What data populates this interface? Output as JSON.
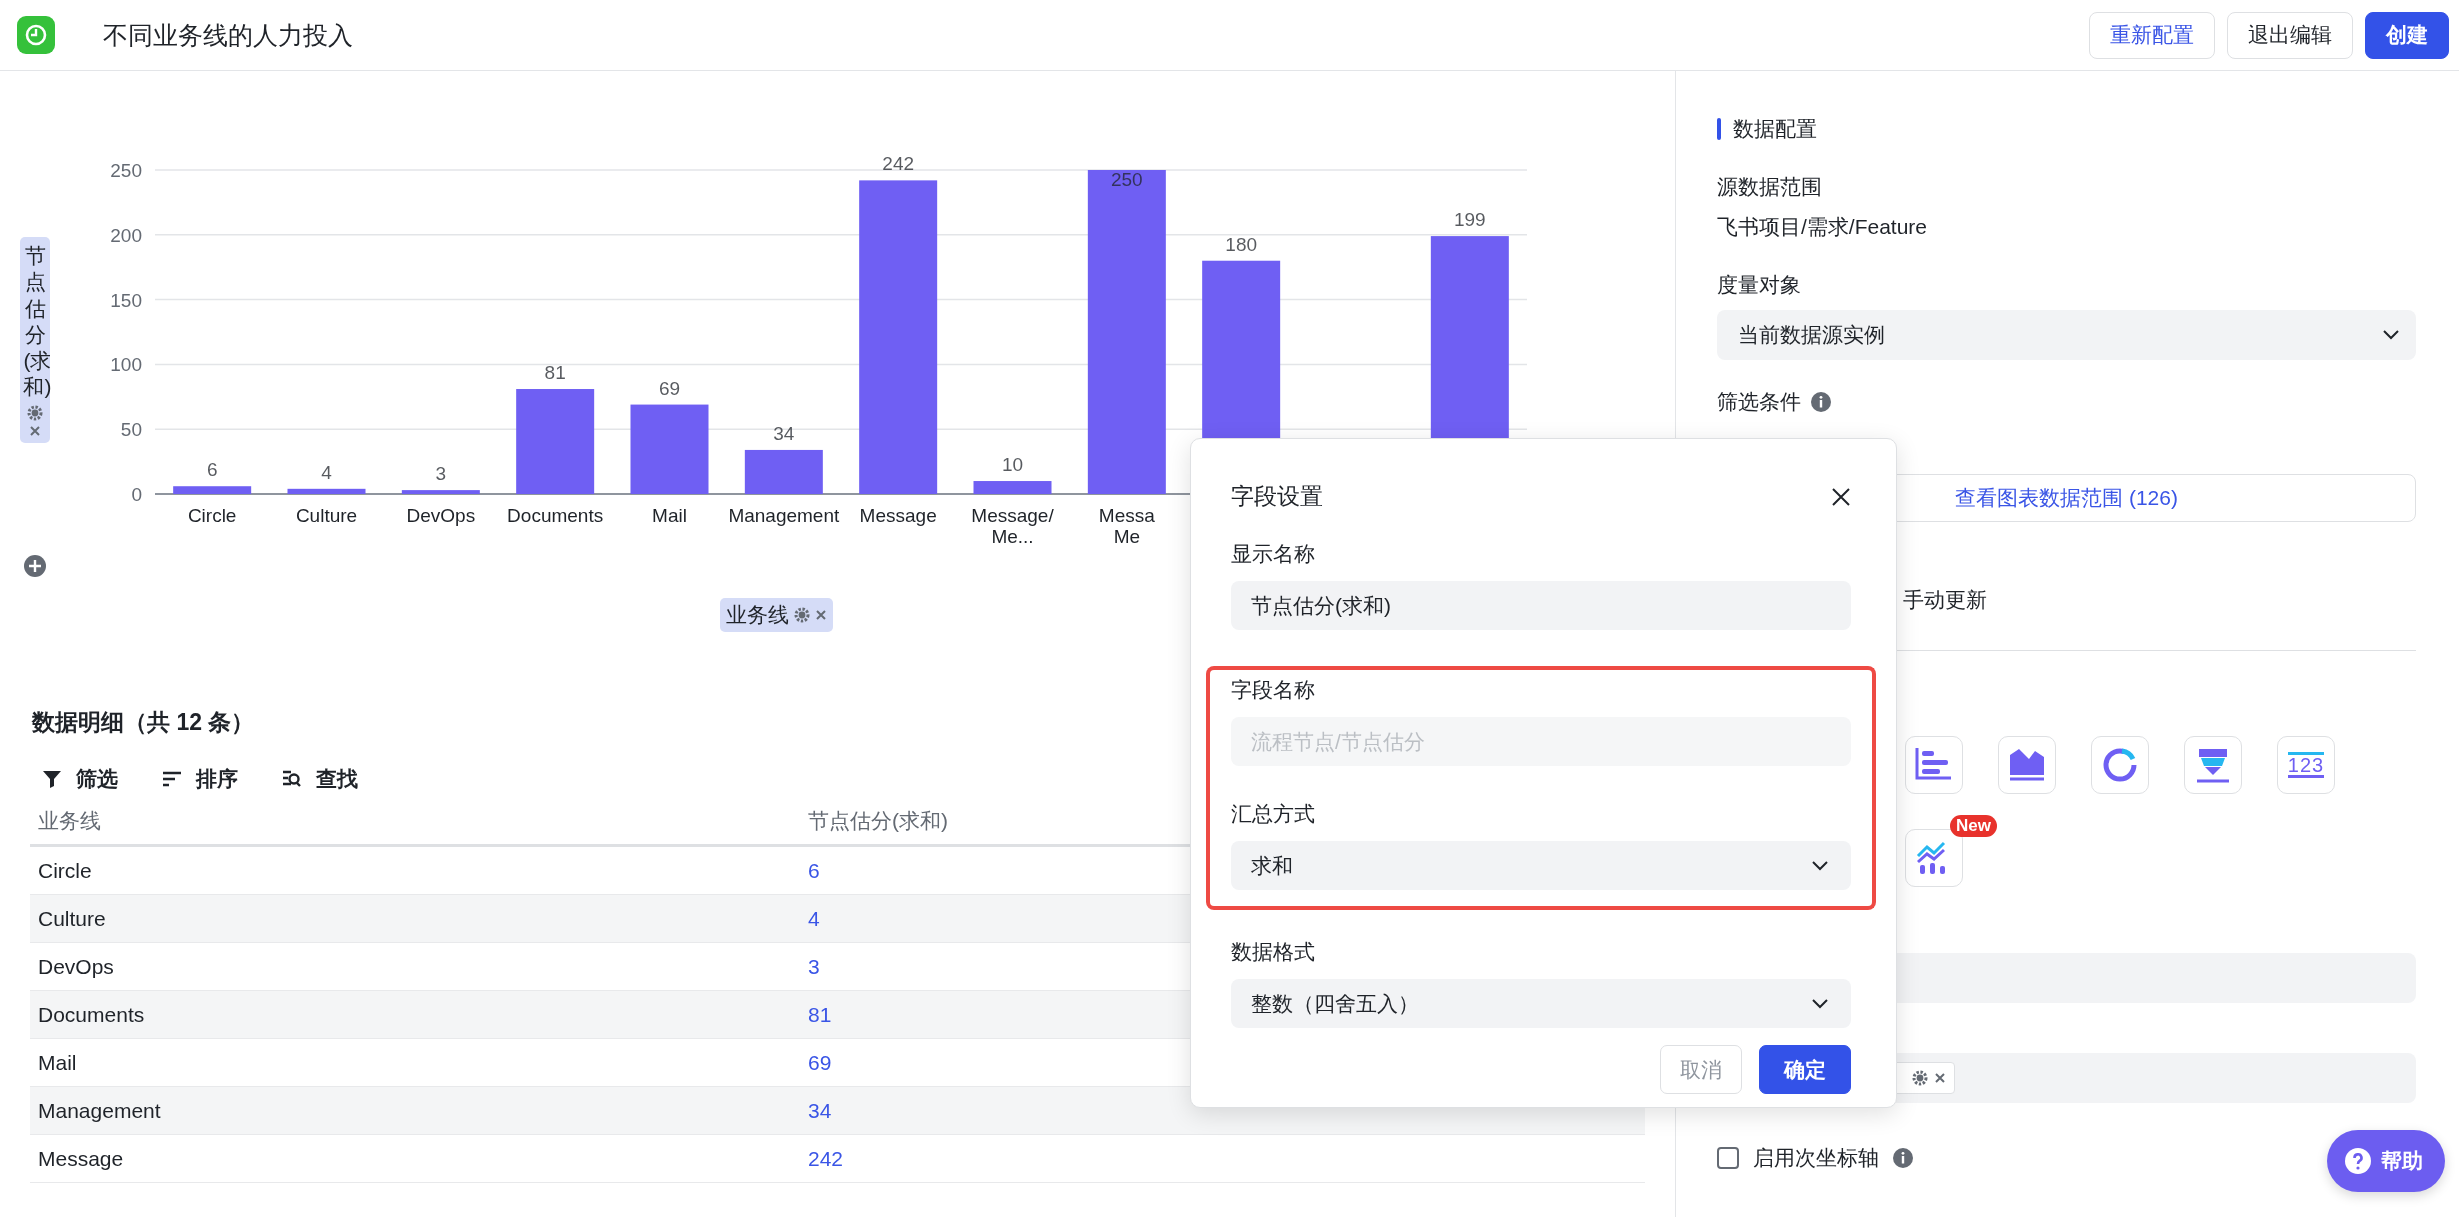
{
  "header": {
    "title": "不同业务线的人力投入",
    "buttons": [
      {
        "label": "重新配置",
        "kind": "outline-accent"
      },
      {
        "label": "退出编辑",
        "kind": "outline"
      },
      {
        "label": "创建",
        "kind": "primary"
      }
    ]
  },
  "chart": {
    "x_field": {
      "label": "业务线"
    },
    "chart_data": {
      "type": "bar",
      "categories": [
        "Circle",
        "Culture",
        "DevOps",
        "Documents",
        "Mail",
        "Management",
        "Message",
        "Message/\nMe...",
        "Messa\nMe",
        null,
        null,
        null
      ],
      "series": [
        {
          "name": "节点估分(求和)",
          "color": "#6f5ff3",
          "values": [
            6,
            4,
            3,
            81,
            69,
            34,
            242,
            10,
            250,
            180,
            null,
            199
          ]
        }
      ],
      "grid": true,
      "ylim": [
        0,
        250
      ],
      "yticks": [
        0,
        50,
        100,
        150,
        200,
        250
      ],
      "value_labels": [
        "6",
        "4",
        "3",
        "81",
        "69",
        "34",
        "242",
        "10",
        "250",
        "180",
        null,
        "199"
      ]
    }
  },
  "details": {
    "title": "数据明细（共 12 条）",
    "tools": [
      {
        "label": "筛选",
        "kind": "filter"
      },
      {
        "label": "排序",
        "kind": "sort"
      },
      {
        "label": "查找",
        "kind": "find"
      }
    ],
    "columns": [
      "业务线",
      "节点估分(求和)"
    ],
    "rows": [
      [
        "Circle",
        "6"
      ],
      [
        "Culture",
        "4"
      ],
      [
        "DevOps",
        "3"
      ],
      [
        "Documents",
        "81"
      ],
      [
        "Mail",
        "69"
      ],
      [
        "Management",
        "34"
      ],
      [
        "Message",
        "242"
      ]
    ]
  },
  "config": {
    "heading": "数据配置",
    "source_label": "源数据范围",
    "source_value": "飞书项目/需求/Feature",
    "measure_label": "度量对象",
    "measure_value": "当前数据源实例",
    "filter_label": "筛选条件",
    "range_button": "查看图表数据范围 (126)",
    "update_label": "手动更新",
    "chart_types": [
      {
        "kind": "hbar"
      },
      {
        "kind": "area"
      },
      {
        "kind": "donut"
      },
      {
        "kind": "funnel"
      },
      {
        "kind": "number",
        "text": "123"
      },
      {
        "kind": "combo",
        "badge": "New"
      }
    ],
    "secondary_axis": {
      "label": "启用次坐标轴",
      "checked": false
    }
  },
  "help": {
    "label": "帮助"
  },
  "dialog": {
    "title": "字段设置",
    "fields": [
      {
        "label": "显示名称",
        "value": "节点估分(求和)",
        "kind": "input",
        "highlighted": false
      },
      {
        "label": "字段名称",
        "value": "流程节点/节点估分",
        "kind": "readonly",
        "highlighted": true
      },
      {
        "label": "汇总方式",
        "value": "求和",
        "kind": "select",
        "highlighted": true
      },
      {
        "label": "数据格式",
        "value": "整数（四舍五入）",
        "kind": "select",
        "highlighted": false
      }
    ],
    "buttons": [
      {
        "label": "取消",
        "kind": "secondary"
      },
      {
        "label": "确定",
        "kind": "primary"
      }
    ]
  }
}
